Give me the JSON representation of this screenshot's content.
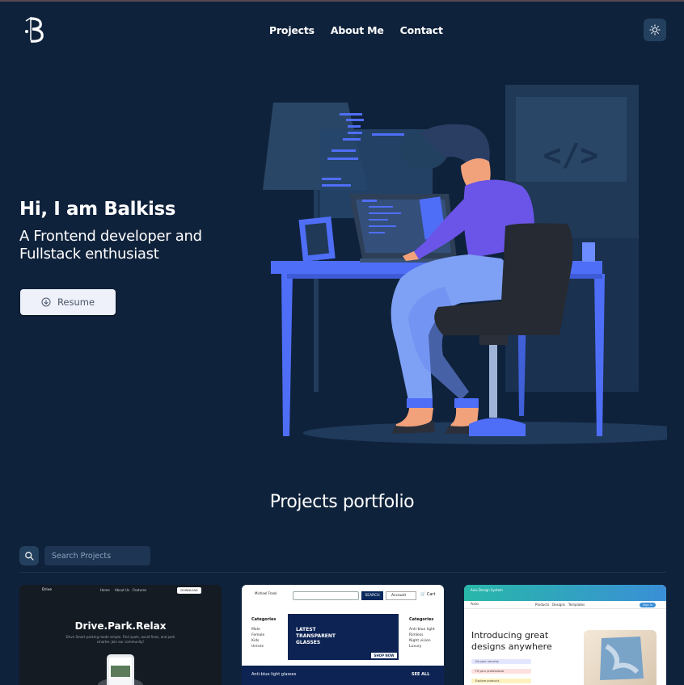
{
  "header": {
    "logo_letter": "B",
    "nav": [
      "Projects",
      "About Me",
      "Contact"
    ],
    "theme_toggle_icon": "sun-icon"
  },
  "hero": {
    "title": "Hi, I am Balkiss",
    "subtitle": "A Frontend developer and Fullstack enthusiast",
    "resume_label": "Resume",
    "resume_icon": "download-circle-icon"
  },
  "portfolio": {
    "title": "Projects portfolio",
    "search": {
      "placeholder": "Search Projects",
      "value": ""
    },
    "cards": [
      {
        "nav_brand": "Drive",
        "nav_links": [
          "Home",
          "About Us",
          "Features"
        ],
        "nav_button": "DOWNLOAD NOW",
        "headline": "Drive.Park.Relax",
        "tagline": "Drive Smart parking made simple. Find spots, avoid fines, and park smarter. Join our community!"
      },
      {
        "logo": "Michael Frank",
        "search_button": "SEARCH",
        "account_label": "Account",
        "cart_label": "Cart",
        "categories_title": "Categories",
        "left_categories": [
          "Male",
          "Female",
          "Kids",
          "Unisex"
        ],
        "right_categories": [
          "Anti-blue light",
          "Rimless",
          "Night vision",
          "Luxury"
        ],
        "banner_text": "LATEST TRANSPARENT GLASSES",
        "banner_button": "SHOP NOW",
        "strip_label": "Anti-blue light glasses",
        "strip_link": "SEE ALL"
      },
      {
        "top_text": "Axio Design System",
        "brand": "Axio",
        "nav_links": [
          "Products",
          "Designs",
          "Templates"
        ],
        "signin": "Sign in",
        "headline": "Introducing great designs anywhere",
        "pills": [
          "Do your security",
          "Fit your professional",
          "Explore products"
        ]
      }
    ]
  },
  "colors": {
    "background": "#0f223b",
    "accent": "#4f6ef7",
    "button_bg": "#eef1fa"
  }
}
